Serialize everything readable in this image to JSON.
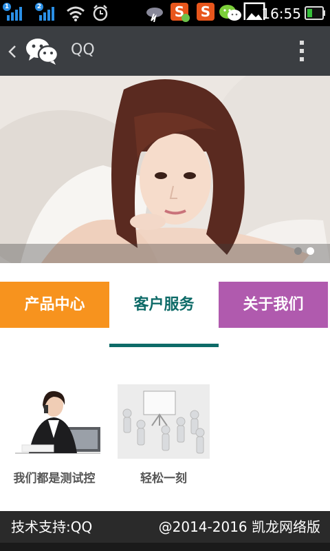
{
  "status_bar": {
    "sim1_label": "1",
    "sim2_label": "2",
    "time": "16:55",
    "icons": [
      "signal-icon",
      "signal-icon",
      "wifi-icon",
      "alarm-icon",
      "weather-icon",
      "sogou-icon",
      "sogou-icon",
      "wechat-icon",
      "image-icon",
      "battery-icon"
    ],
    "battery_level": 0.35,
    "accent": "#2a8fe6"
  },
  "app_bar": {
    "title": "QQ",
    "icons": [
      "back-icon",
      "wechat-icon",
      "more-icon"
    ]
  },
  "banner": {
    "slide_count": 2,
    "active_slide": 2
  },
  "tabs": [
    {
      "label": "产品中心",
      "color": "#f7931e"
    },
    {
      "label": "客户服务",
      "color": "#ffffff"
    },
    {
      "label": "关于我们",
      "color": "#b05aae"
    }
  ],
  "items": [
    {
      "caption": "我们都是测试控"
    },
    {
      "caption": "轻松一刻"
    }
  ],
  "footer": {
    "left": "技术支持:QQ",
    "right": "@2014-2016 凯龙网络版"
  }
}
